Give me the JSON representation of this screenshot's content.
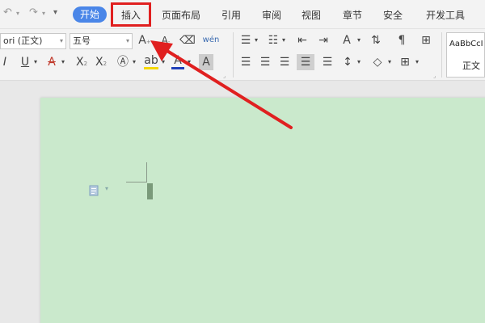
{
  "menubar": {
    "tabs": [
      {
        "label": "开始",
        "active": true
      },
      {
        "label": "插入"
      },
      {
        "label": "页面布局"
      },
      {
        "label": "引用"
      },
      {
        "label": "审阅"
      },
      {
        "label": "视图"
      },
      {
        "label": "章节"
      },
      {
        "label": "安全"
      },
      {
        "label": "开发工具"
      }
    ]
  },
  "ribbon": {
    "font_name": "ori (正文)",
    "font_size": "五号",
    "style_sample": "AaBbCcI",
    "style_name": "正文"
  },
  "colors": {
    "accent": "#4a86e8",
    "annotation_red": "#e02020",
    "page_background": "#cae9cc"
  }
}
